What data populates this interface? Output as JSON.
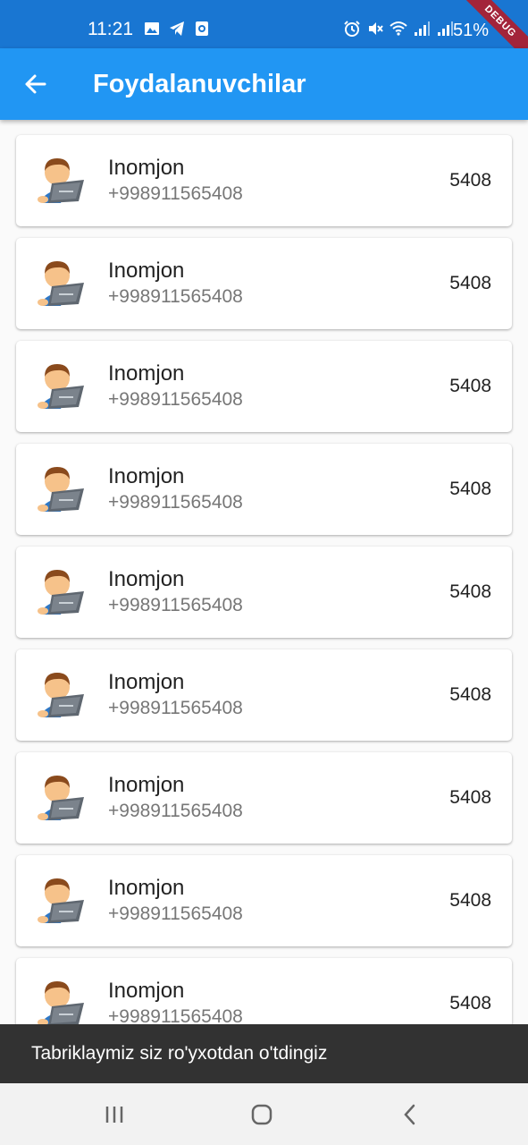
{
  "status_bar": {
    "time": "11:21",
    "battery": "51%",
    "left_icons": [
      "image-icon",
      "telegram-icon",
      "app-notification-icon"
    ],
    "right_icons": [
      "alarm-icon",
      "mute-icon",
      "wifi-icon",
      "signal-icon",
      "signal-icon"
    ],
    "debug_label": "DEBUG"
  },
  "app_bar": {
    "back_icon": "arrow-back-icon",
    "title": "Foydalanuvchilar"
  },
  "users": [
    {
      "name": "Inomjon",
      "phone": "+998911565408",
      "code": "5408",
      "avatar": "person-with-laptop-icon"
    },
    {
      "name": "Inomjon",
      "phone": "+998911565408",
      "code": "5408",
      "avatar": "person-with-laptop-icon"
    },
    {
      "name": "Inomjon",
      "phone": "+998911565408",
      "code": "5408",
      "avatar": "person-with-laptop-icon"
    },
    {
      "name": "Inomjon",
      "phone": "+998911565408",
      "code": "5408",
      "avatar": "person-with-laptop-icon"
    },
    {
      "name": "Inomjon",
      "phone": "+998911565408",
      "code": "5408",
      "avatar": "person-with-laptop-icon"
    },
    {
      "name": "Inomjon",
      "phone": "+998911565408",
      "code": "5408",
      "avatar": "person-with-laptop-icon"
    },
    {
      "name": "Inomjon",
      "phone": "+998911565408",
      "code": "5408",
      "avatar": "person-with-laptop-icon"
    },
    {
      "name": "Inomjon",
      "phone": "+998911565408",
      "code": "5408",
      "avatar": "person-with-laptop-icon"
    },
    {
      "name": "Inomjon",
      "phone": "+998911565408",
      "code": "5408",
      "avatar": "person-with-laptop-icon"
    }
  ],
  "snackbar": {
    "message": "Tabriklaymiz siz ro'yxotdan o'tdingiz"
  },
  "nav_bar": {
    "buttons": [
      "recent-apps-icon",
      "home-icon",
      "back-icon"
    ]
  },
  "colors": {
    "status_bar": "#1976d2",
    "app_bar": "#2196f3",
    "snackbar": "#323232"
  }
}
